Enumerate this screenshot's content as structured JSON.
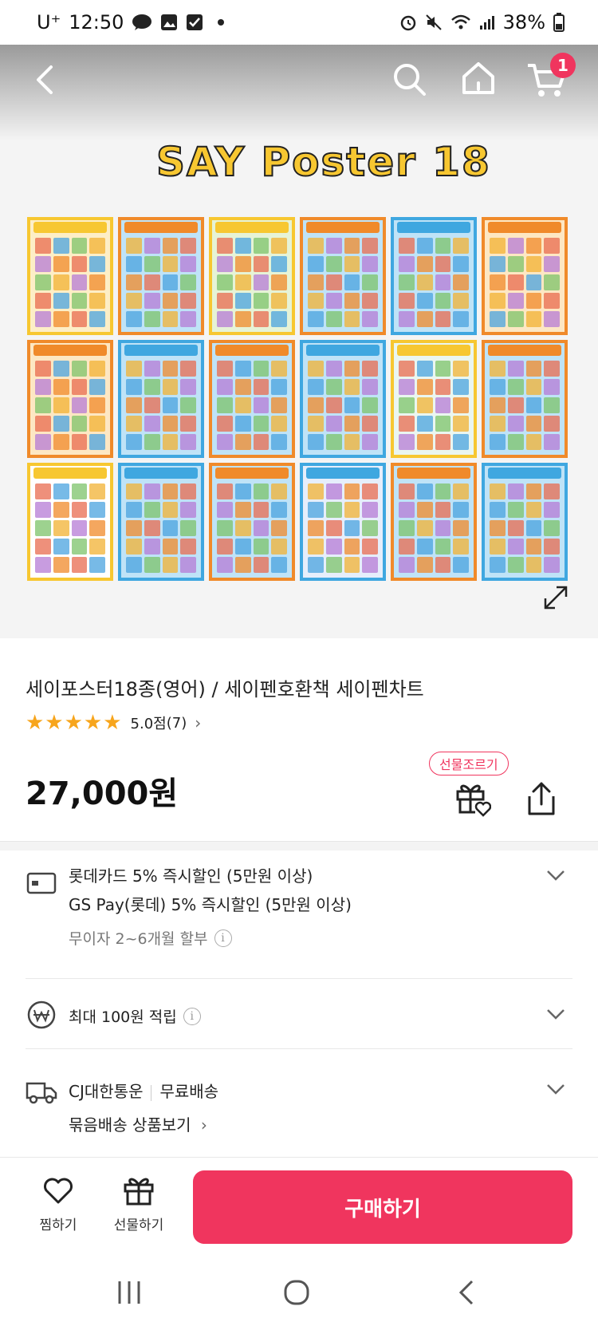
{
  "status_bar": {
    "carrier": "U⁺",
    "time": "12:50",
    "battery": "38%"
  },
  "nav": {
    "cart_badge": "1",
    "icons": [
      "back-icon",
      "search-icon",
      "home-icon",
      "cart-icon"
    ]
  },
  "hero": {
    "poster_title": "SAY Poster 18",
    "poster_head_colors": [
      "#f7c731",
      "#f08a2a",
      "#f7c731",
      "#f08a2a",
      "#3fa7e0",
      "#f08a2a",
      "#f08a2a",
      "#3fa7e0",
      "#f08a2a",
      "#3fa7e0",
      "#f7c731",
      "#f08a2a",
      "#f7c731",
      "#3fa7e0",
      "#f08a2a",
      "#3fa7e0",
      "#f08a2a",
      "#3fa7e0"
    ],
    "poster_bg_colors": [
      "#fdeec6",
      "#bfe3f7",
      "#e6f3d6",
      "#bfe3f7",
      "#bfe3f7",
      "#fde7c3",
      "#fde7c3",
      "#bfe3f7",
      "#bfe3f7",
      "#bfe3f7",
      "#eaf6f0",
      "#bfe3f7",
      "#ffffff",
      "#bfe3f7",
      "#bfe3f7",
      "#e6eefb",
      "#bfe3f7",
      "#bfe3f7"
    ]
  },
  "product": {
    "name": "세이포스터18종(영어) / 세이펜호환책 세이펜차트",
    "stars": "★★★★★",
    "rating": "5.0점",
    "review_count": "(7)",
    "price": "27,000원",
    "gift_tag": "선물조르기"
  },
  "benefits": {
    "card_line1": "롯데카드 5% 즉시할인 (5만원 이상)",
    "card_line2": "GS Pay(롯데) 5% 즉시할인 (5만원 이상)",
    "installment": "무이자 2~6개월 할부",
    "points": "최대 100원 적립",
    "courier": "CJ대한통운",
    "shipping": "무료배송",
    "bundle": "묶음배송 상품보기"
  },
  "bottom_bar": {
    "wish_label": "찜하기",
    "gift_label": "선물하기",
    "buy_label": "구매하기"
  },
  "colors": {
    "accent": "#f0355e",
    "star": "#f7a51c"
  }
}
